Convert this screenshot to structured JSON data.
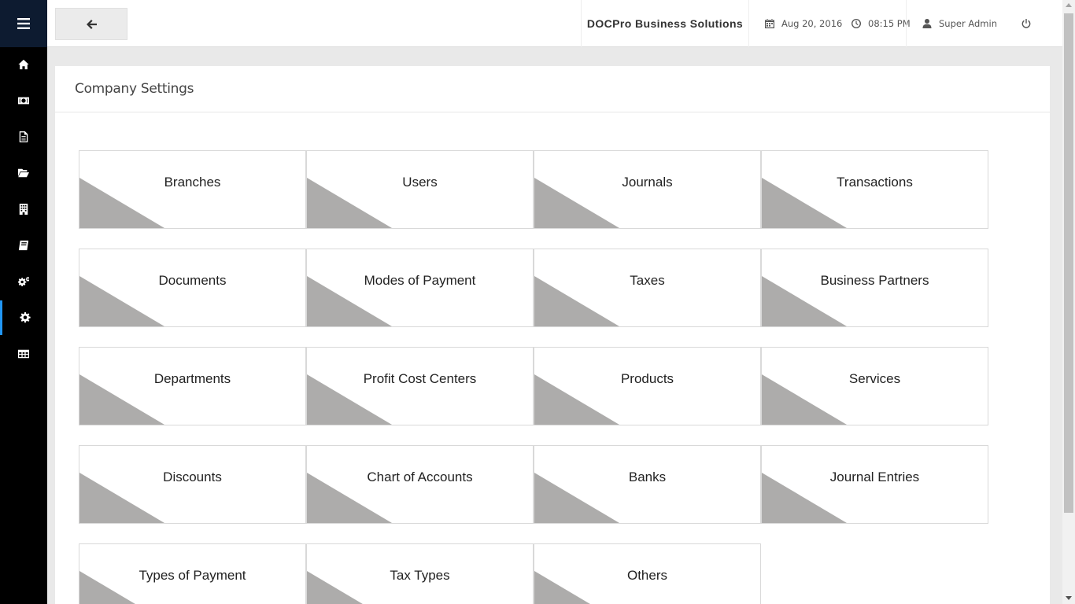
{
  "header": {
    "brand": "DOCPro Business Solutions",
    "date": "Aug 20, 2016",
    "time": "08:15 PM",
    "user": "Super Admin"
  },
  "sidebar": {
    "items": [
      {
        "icon": "home-icon"
      },
      {
        "icon": "money-icon"
      },
      {
        "icon": "document-icon"
      },
      {
        "icon": "folder-open-icon"
      },
      {
        "icon": "building-icon"
      },
      {
        "icon": "book-icon"
      },
      {
        "icon": "cogs-icon"
      },
      {
        "icon": "gear-icon",
        "active": true
      },
      {
        "icon": "table-icon"
      }
    ],
    "accent": "#2196f3"
  },
  "page": {
    "title": "Company Settings"
  },
  "tiles": [
    "Branches",
    "Users",
    "Journals",
    "Transactions",
    "Documents",
    "Modes of Payment",
    "Taxes",
    "Business Partners",
    "Departments",
    "Profit Cost Centers",
    "Products",
    "Services",
    "Discounts",
    "Chart of Accounts",
    "Banks",
    "Journal Entries",
    "Types of Payment",
    "Tax Types",
    "Others"
  ]
}
